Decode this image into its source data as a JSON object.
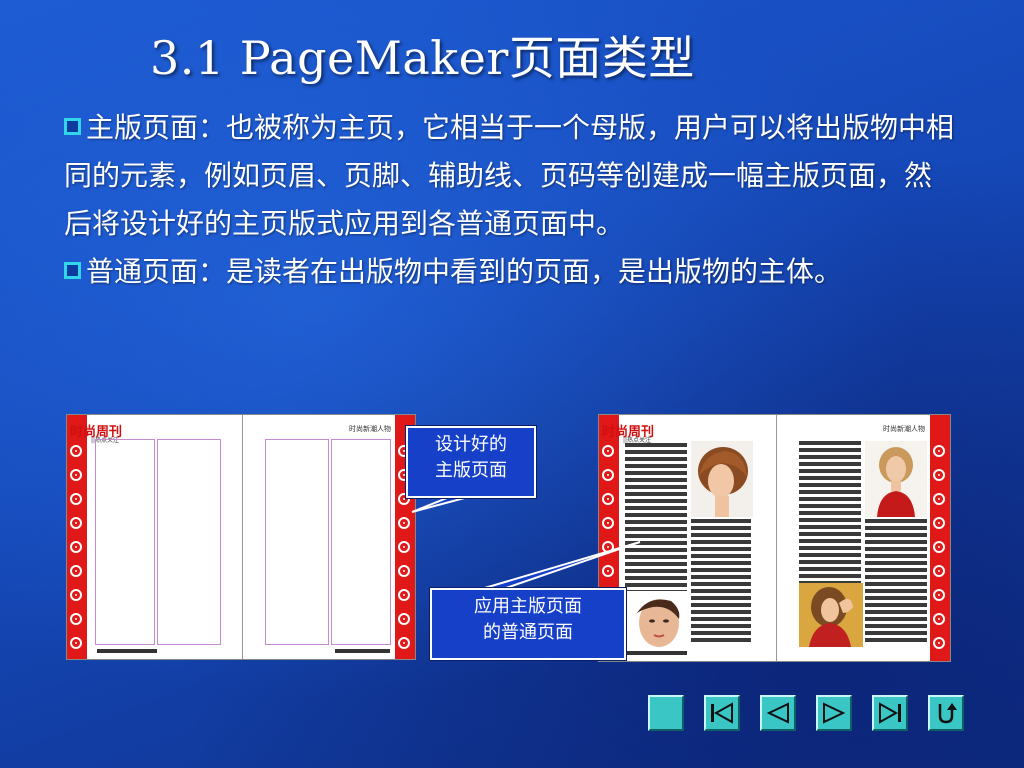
{
  "slide": {
    "title": "3.1  PageMaker页面类型",
    "paragraphs": [
      {
        "bullet": true,
        "text": "主版页面：也被称为主页，它相当于一个母版，用户可以将出版物中相同的元素，例如页眉、页脚、辅助线、页码等创建成一幅主版页面，然后将设计好的主页版式应用到各普通页面中。"
      },
      {
        "bullet": true,
        "text": "普通页面：是读者在出版物中看到的页面，是出版物的主体。"
      }
    ]
  },
  "spreads": {
    "master": {
      "magazine_title": "时尚周刊",
      "left_subtitle": "||热点关注",
      "right_header": "时尚新潮人物"
    },
    "normal": {
      "magazine_title": "时尚周刊",
      "left_subtitle": "||热点关注",
      "right_header": "时尚新潮人物"
    }
  },
  "callouts": {
    "master_lines": [
      "设计好的",
      "主版页面"
    ],
    "normal_lines": [
      "应用主版页面",
      "的普通页面"
    ]
  },
  "colors": {
    "background": "#1548b8",
    "bullet_border": "#33d6e8",
    "callout_fill": "#1740c8",
    "strip_red": "#e01818",
    "nav_button": "#3bc6c6"
  },
  "navigation": {
    "buttons": [
      {
        "name": "home-button",
        "icon": "blank-square-icon"
      },
      {
        "name": "first-slide-button",
        "icon": "first-slide-icon"
      },
      {
        "name": "previous-slide-button",
        "icon": "previous-arrow-icon"
      },
      {
        "name": "next-slide-button",
        "icon": "next-arrow-icon"
      },
      {
        "name": "last-slide-button",
        "icon": "last-slide-icon"
      },
      {
        "name": "return-button",
        "icon": "return-icon"
      }
    ]
  }
}
